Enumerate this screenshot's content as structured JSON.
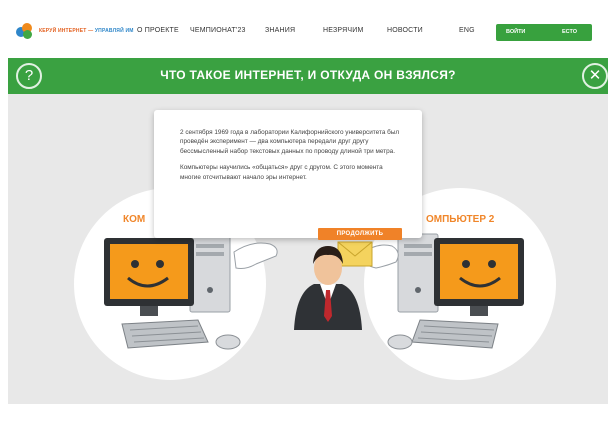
{
  "header": {
    "logo_text_main": "КЕРУЙ ИНТЕРНЕТ —",
    "logo_text_accent": "УПРАВЛЯЙ ИМ",
    "nav": [
      "О ПРОЕКТЕ",
      "ЧЕМПИОНАТ'23",
      "ЗНАНИЯ",
      "НЕЗРЯЧИМ",
      "НОВОСТИ",
      "ENG"
    ],
    "button_left": "ВОЙТИ",
    "button_right": "ЕСТО"
  },
  "band": {
    "title": "ЧТО ТАКОЕ ИНТЕРНЕТ, И ОТКУДА ОН ВЗЯЛСЯ?",
    "help_icon": "?",
    "close_icon": "✕"
  },
  "popup": {
    "paragraph1": "2 сентября 1969 года в лаборатории Калифорнийского университета был проведён эксперимент — два компьютера передали друг другу бессмысленный набор текстовых данных по проводу длиной три метра.",
    "paragraph2": "Компьютеры научились «общаться» друг с другом. С этого момента многие отсчитывают начало эры интернет.",
    "continue_label": "ПРОДОЛЖИТЬ"
  },
  "scene": {
    "left_label": "КОМ",
    "right_label": "ОМПЬЮТЕР 2"
  },
  "colors": {
    "green": "#3aa141",
    "orange": "#f08228",
    "blue": "#2e86c9"
  }
}
